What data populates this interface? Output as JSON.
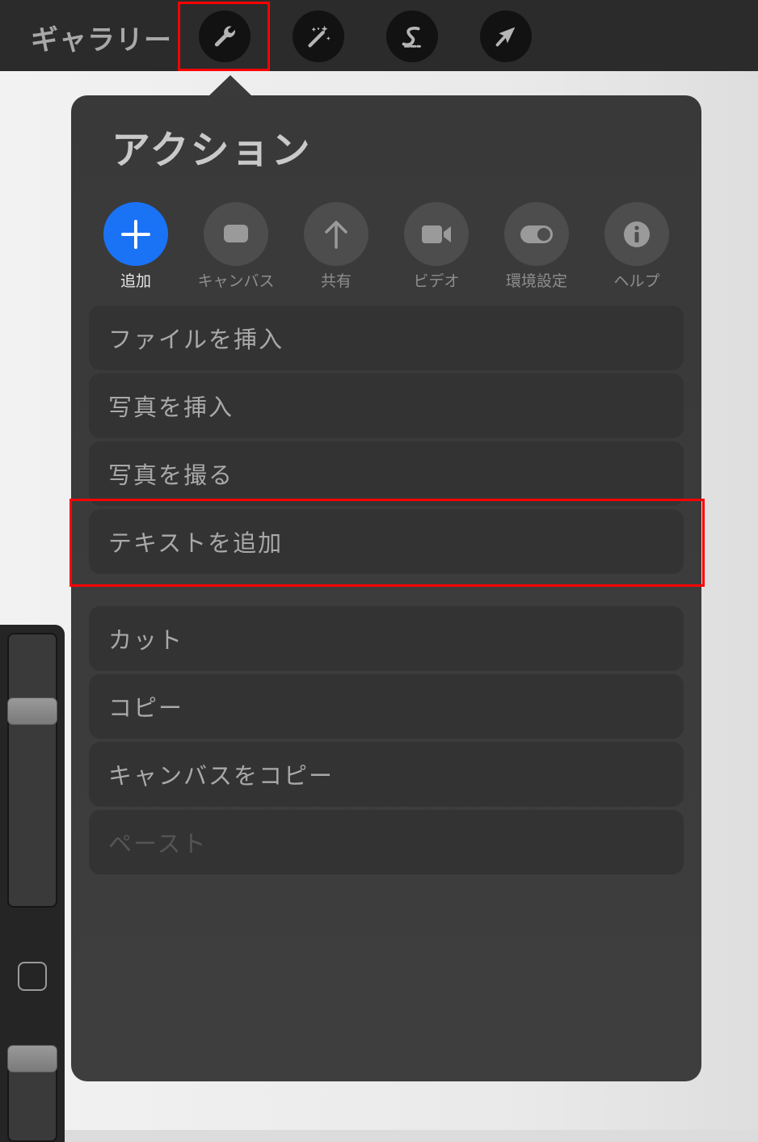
{
  "topbar": {
    "gallery_label": "ギャラリー",
    "tools": [
      {
        "name": "wrench-icon",
        "selected": true
      },
      {
        "name": "magic-wand-icon",
        "selected": false
      },
      {
        "name": "selection-s-icon",
        "selected": false
      },
      {
        "name": "transform-arrow-icon",
        "selected": false
      }
    ]
  },
  "popover": {
    "title": "アクション",
    "tabs": [
      {
        "label": "追加",
        "icon": "plus-icon",
        "active": true
      },
      {
        "label": "キャンバス",
        "icon": "canvas-icon",
        "active": false
      },
      {
        "label": "共有",
        "icon": "share-arrow-up-icon",
        "active": false
      },
      {
        "label": "ビデオ",
        "icon": "video-camera-icon",
        "active": false
      },
      {
        "label": "環境設定",
        "icon": "toggle-icon",
        "active": false
      },
      {
        "label": "ヘルプ",
        "icon": "info-icon",
        "active": false
      }
    ],
    "menu_group_1": [
      {
        "label": "ファイルを挿入"
      },
      {
        "label": "写真を挿入"
      },
      {
        "label": "写真を撮る"
      },
      {
        "label": "テキストを追加",
        "highlighted": true
      }
    ],
    "menu_group_2": [
      {
        "label": "カット"
      },
      {
        "label": "コピー"
      },
      {
        "label": "キャンバスをコピー"
      },
      {
        "label": "ペースト",
        "disabled": true
      }
    ]
  },
  "colors": {
    "accent": "#1a73f5",
    "highlight_box": "#ff0000"
  }
}
